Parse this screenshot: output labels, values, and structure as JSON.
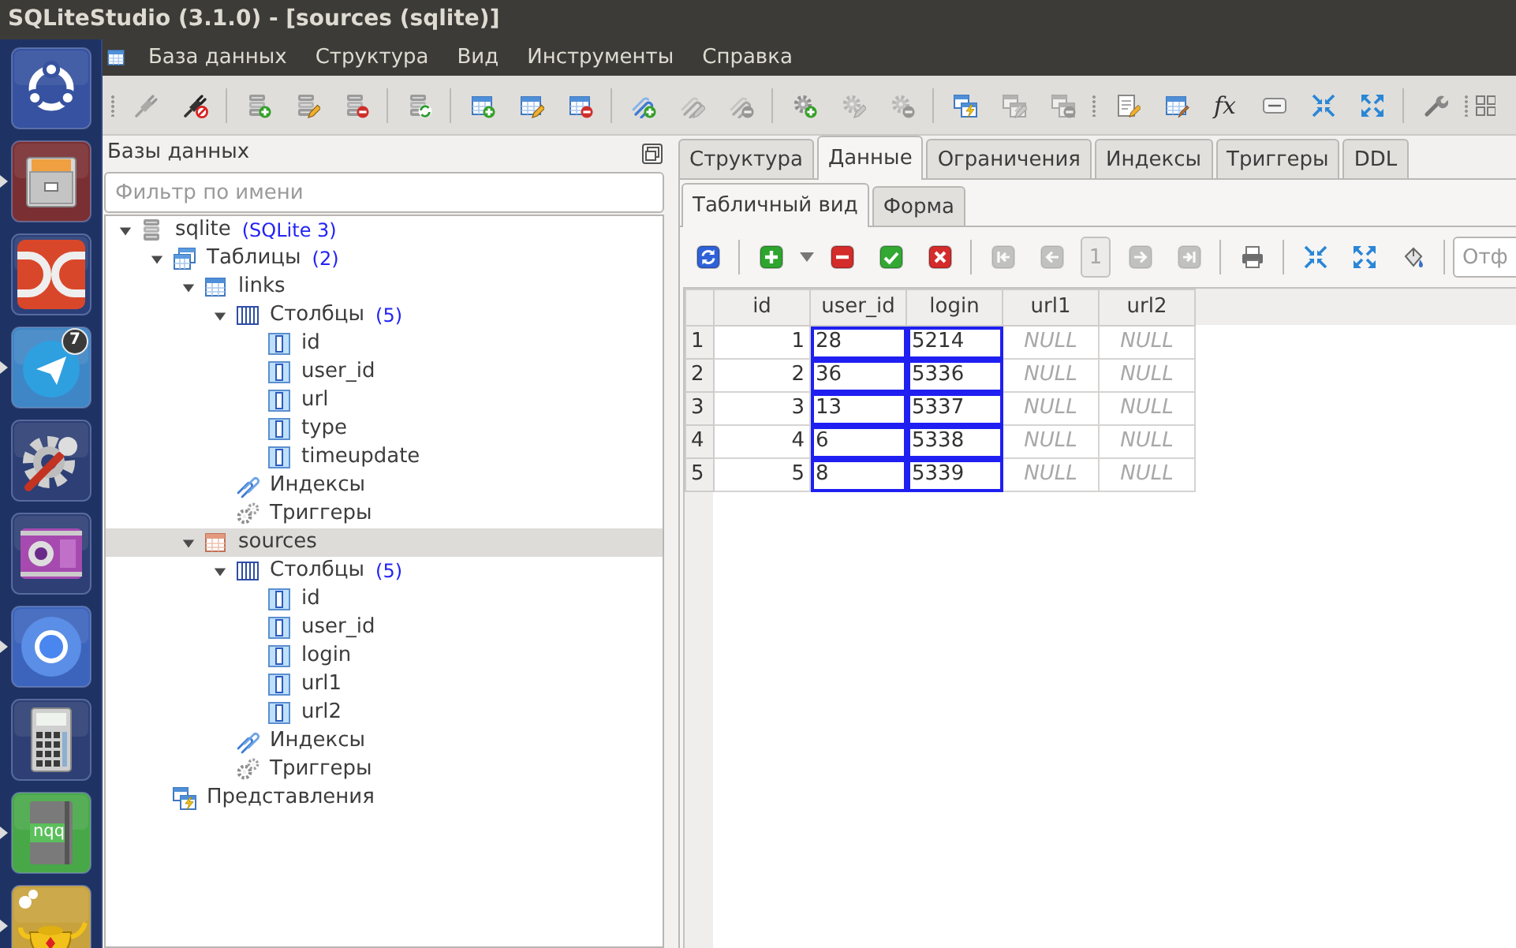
{
  "window": {
    "title": "SQLiteStudio (3.1.0) - [sources (sqlite)]"
  },
  "launcher": [
    {
      "running": false
    },
    {
      "running": true
    },
    {
      "running": false
    },
    {
      "running": true,
      "badge": "7"
    },
    {
      "running": false
    },
    {
      "running": false
    },
    {
      "running": true
    },
    {
      "running": false
    },
    {
      "running": true,
      "label": "nqq"
    },
    {
      "running": true
    }
  ],
  "menu": [
    "База данных",
    "Структура",
    "Вид",
    "Инструменты",
    "Справка"
  ],
  "toolbar": [
    {
      "disabled": true
    },
    {
      "disabled": false
    },
    {
      "disabled": false
    },
    {
      "disabled": false
    },
    {
      "disabled": false
    },
    {
      "disabled": false
    },
    {
      "disabled": false
    },
    {
      "disabled": false
    },
    {
      "disabled": false
    },
    {
      "disabled": false
    },
    {
      "disabled": true
    },
    {
      "disabled": true
    },
    {
      "disabled": false
    },
    {
      "disabled": true
    },
    {
      "disabled": true
    },
    {
      "disabled": false
    },
    {
      "disabled": true
    },
    {
      "disabled": true
    },
    {
      "disabled": false
    },
    {
      "disabled": false
    },
    {
      "disabled": false,
      "text": "fx"
    },
    {
      "disabled": false
    },
    {
      "disabled": false
    },
    {
      "disabled": false
    },
    {
      "disabled": false
    },
    {
      "disabled": false
    }
  ],
  "databases_panel": {
    "title": "Базы данных",
    "filter": {
      "placeholder": "Фильтр по имени"
    },
    "tree": [
      {
        "kind": "database",
        "label": "sqlite",
        "note": "(SQLite 3)",
        "expanded": true,
        "selected": false,
        "children": [
          {
            "kind": "tables",
            "label": "Таблицы",
            "note": "(2)",
            "expanded": true,
            "selected": false,
            "children": [
              {
                "kind": "table",
                "label": "links",
                "expanded": true,
                "selected": false,
                "children": [
                  {
                    "kind": "columns",
                    "label": "Столбцы",
                    "note": "(5)",
                    "expanded": true,
                    "selected": false,
                    "children": [
                      {
                        "kind": "column",
                        "label": "id",
                        "selected": false
                      },
                      {
                        "kind": "column",
                        "label": "user_id",
                        "selected": false
                      },
                      {
                        "kind": "column",
                        "label": "url",
                        "selected": false
                      },
                      {
                        "kind": "column",
                        "label": "type",
                        "selected": false
                      },
                      {
                        "kind": "column",
                        "label": "timeupdate",
                        "selected": false
                      }
                    ]
                  },
                  {
                    "kind": "indexes",
                    "label": "Индексы",
                    "selected": false
                  },
                  {
                    "kind": "triggers",
                    "label": "Триггеры",
                    "selected": false
                  }
                ]
              },
              {
                "kind": "table",
                "label": "sources",
                "expanded": true,
                "selected": true,
                "children": [
                  {
                    "kind": "columns",
                    "label": "Столбцы",
                    "note": "(5)",
                    "expanded": true,
                    "selected": false,
                    "children": [
                      {
                        "kind": "column",
                        "label": "id",
                        "selected": false
                      },
                      {
                        "kind": "column",
                        "label": "user_id",
                        "selected": false
                      },
                      {
                        "kind": "column",
                        "label": "login",
                        "selected": false
                      },
                      {
                        "kind": "column",
                        "label": "url1",
                        "selected": false
                      },
                      {
                        "kind": "column",
                        "label": "url2",
                        "selected": false
                      }
                    ]
                  },
                  {
                    "kind": "indexes",
                    "label": "Индексы",
                    "selected": false
                  },
                  {
                    "kind": "triggers",
                    "label": "Триггеры",
                    "selected": false
                  }
                ]
              }
            ]
          },
          {
            "kind": "views",
            "label": "Представления",
            "selected": false
          }
        ]
      }
    ]
  },
  "editor": {
    "tabs": [
      {
        "label": "Структура",
        "selected": false
      },
      {
        "label": "Данные",
        "selected": true
      },
      {
        "label": "Ограничения",
        "selected": false
      },
      {
        "label": "Индексы",
        "selected": false
      },
      {
        "label": "Триггеры",
        "selected": false
      },
      {
        "label": "DDL",
        "selected": false
      }
    ],
    "subtabs": [
      {
        "label": "Табличный вид",
        "selected": true
      },
      {
        "label": "Форма",
        "selected": false
      }
    ],
    "data_toolbar": {
      "buttons": [
        {
          "disabled": false
        },
        {
          "disabled": false
        },
        {
          "disabled": false
        },
        {
          "disabled": false
        },
        {
          "disabled": false
        },
        {
          "disabled": true
        },
        {
          "disabled": true
        },
        {
          "disabled": true
        },
        {
          "disabled": true
        },
        {
          "disabled": false
        },
        {
          "disabled": false
        },
        {
          "disabled": false
        },
        {
          "disabled": false
        }
      ],
      "page": {
        "value": "1",
        "disabled": true
      },
      "filter": {
        "placeholder": "Отф"
      }
    },
    "grid": {
      "columns": [
        "id",
        "user_id",
        "login",
        "url1",
        "url2"
      ],
      "rows": [
        {
          "number": "1",
          "cells": [
            {
              "text": "1",
              "kind": "integer",
              "selected": false
            },
            {
              "text": "28",
              "kind": "text",
              "selected": true
            },
            {
              "text": "5214",
              "kind": "text",
              "selected": true
            },
            {
              "text": "NULL",
              "kind": "null",
              "selected": false
            },
            {
              "text": "NULL",
              "kind": "null",
              "selected": false
            }
          ]
        },
        {
          "number": "2",
          "cells": [
            {
              "text": "2",
              "kind": "integer",
              "selected": false
            },
            {
              "text": "36",
              "kind": "text",
              "selected": true
            },
            {
              "text": "5336",
              "kind": "text",
              "selected": true
            },
            {
              "text": "NULL",
              "kind": "null",
              "selected": false
            },
            {
              "text": "NULL",
              "kind": "null",
              "selected": false
            }
          ]
        },
        {
          "number": "3",
          "cells": [
            {
              "text": "3",
              "kind": "integer",
              "selected": false
            },
            {
              "text": "13",
              "kind": "text",
              "selected": true
            },
            {
              "text": "5337",
              "kind": "text",
              "selected": true
            },
            {
              "text": "NULL",
              "kind": "null",
              "selected": false
            },
            {
              "text": "NULL",
              "kind": "null",
              "selected": false
            }
          ]
        },
        {
          "number": "4",
          "cells": [
            {
              "text": "4",
              "kind": "integer",
              "selected": false
            },
            {
              "text": "6",
              "kind": "text",
              "selected": true
            },
            {
              "text": "5338",
              "kind": "text",
              "selected": true
            },
            {
              "text": "NULL",
              "kind": "null",
              "selected": false
            },
            {
              "text": "NULL",
              "kind": "null",
              "selected": false
            }
          ]
        },
        {
          "number": "5",
          "cells": [
            {
              "text": "5",
              "kind": "integer",
              "selected": false
            },
            {
              "text": "8",
              "kind": "text",
              "selected": true
            },
            {
              "text": "5339",
              "kind": "text",
              "selected": true
            },
            {
              "text": "NULL",
              "kind": "null",
              "selected": false
            },
            {
              "text": "NULL",
              "kind": "null",
              "selected": false
            }
          ]
        }
      ]
    }
  }
}
